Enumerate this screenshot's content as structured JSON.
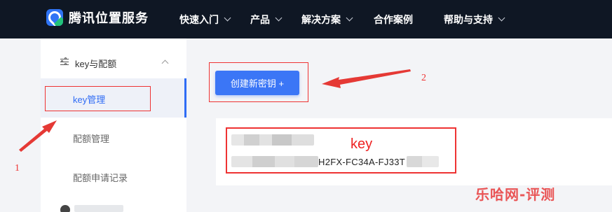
{
  "header": {
    "brand": "腾讯位置服务",
    "nav": [
      {
        "label": "快速入门",
        "has_menu": true
      },
      {
        "label": "产品",
        "has_menu": true
      },
      {
        "label": "解决方案",
        "has_menu": true
      },
      {
        "label": "合作案例",
        "has_menu": false
      },
      {
        "label": "帮助与支持",
        "has_menu": true
      }
    ]
  },
  "sidebar": {
    "group_label": "key与配额",
    "items": [
      {
        "label": "key管理",
        "active": true
      },
      {
        "label": "配额管理",
        "active": false
      },
      {
        "label": "配额申请记录",
        "active": false
      }
    ]
  },
  "main": {
    "create_button": "创建新密钥 +",
    "key_card": {
      "visible_key_part": "H2FX-FC34A-FJ33T"
    }
  },
  "annotations": {
    "label_1": "1",
    "label_2": "2",
    "key_label": "key",
    "color": "#e33333"
  },
  "watermark": "乐哈网-评测"
}
